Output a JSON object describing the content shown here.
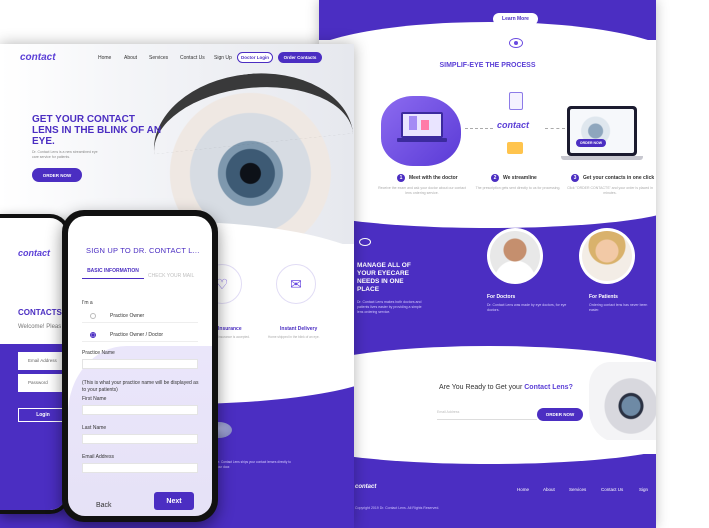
{
  "right_page": {
    "learn_more": "Learn More",
    "process_title": "SIMPLIF-EYE THE PROCESS",
    "illus_logo": "contact",
    "order_now_screen": "ORDER NOW",
    "steps": [
      {
        "num": "1",
        "label": "Meet with the doctor",
        "desc": "Receive the exam and ask your doctor about our contact lens ordering service."
      },
      {
        "num": "2",
        "label": "We streamline",
        "desc": "The prescription gets sent directly to us for processing."
      },
      {
        "num": "3",
        "label": "Get your contacts in one click",
        "desc": "Click \"ORDER CONTACTS\" and your order is placed in minutes."
      }
    ],
    "manage_title": "MANAGE ALL OF YOUR EYECARE NEEDS IN ONE PLACE",
    "manage_desc": "Dr. Contact Lens makes both doctors and patients lives easier by providing a simple lens ordering service.",
    "audiences": [
      {
        "title": "For Doctors",
        "desc": "Dr. Contact Lens was made by eye doctors, for eye doctors."
      },
      {
        "title": "For Patients",
        "desc": "Ordering contact lens has never been easier."
      }
    ],
    "cta_question": "Are You Ready to Get your ",
    "cta_question_bold": "Contact Lens?",
    "cta_input_placeholder": "Email Address",
    "cta_button": "ORDER NOW",
    "footer_logo": "contact",
    "footer_nav": [
      "Home",
      "About",
      "Services",
      "Contact Us",
      "Sign"
    ],
    "copyright": "Copyright 2019 Dr. Contact Lens. All Rights Reserved."
  },
  "mid_page": {
    "logo": "contact",
    "nav": [
      "Home",
      "About",
      "Services",
      "Contact Us",
      "Sign Up"
    ],
    "doctor_login": "Doctor Login",
    "order_contacts": "Order Contacts",
    "headline": "GET YOUR CONTACT LENS IN THE BLINK OF AN EYE.",
    "sub": "Dr. Contact Lens is a new streamlined eye care service for patients.",
    "order_now": "ORDER NOW",
    "features": [
      {
        "icon": "♡",
        "title": "Insurance",
        "desc": "Insurance is accepted."
      },
      {
        "icon": "✉",
        "title": "Instant Delivery",
        "desc": "Home shipped in the blink of an eye."
      }
    ],
    "bottom_text": "Dr. Contact Lens ships your contact lenses directly to your door."
  },
  "phone_back": {
    "logo": "contact",
    "contacts_title": "CONTACTS",
    "welcome": "Welcome! Pleas",
    "email_placeholder": "Email Address",
    "password_placeholder": "Password",
    "login": "Login"
  },
  "phone_front": {
    "title": "SIGN UP TO DR. CONTACT L...",
    "tab_basic": "BASIC INFORMATION",
    "tab_check": "CHECK YOUR MAIL",
    "ima_label": "I'm a",
    "options": [
      "Practice Owner",
      "Practice Owner / Doctor"
    ],
    "selected_option": 1,
    "practice_name_label": "Practice Name",
    "practice_note": "(This is what your practice name will be displayed as to your patients)",
    "first_name_label": "First Name",
    "last_name_label": "Last Name",
    "email_label": "Email Address",
    "back": "Back",
    "next": "Next"
  },
  "colors": {
    "brand": "#4b2ec2",
    "accent": "#6a4be0"
  }
}
